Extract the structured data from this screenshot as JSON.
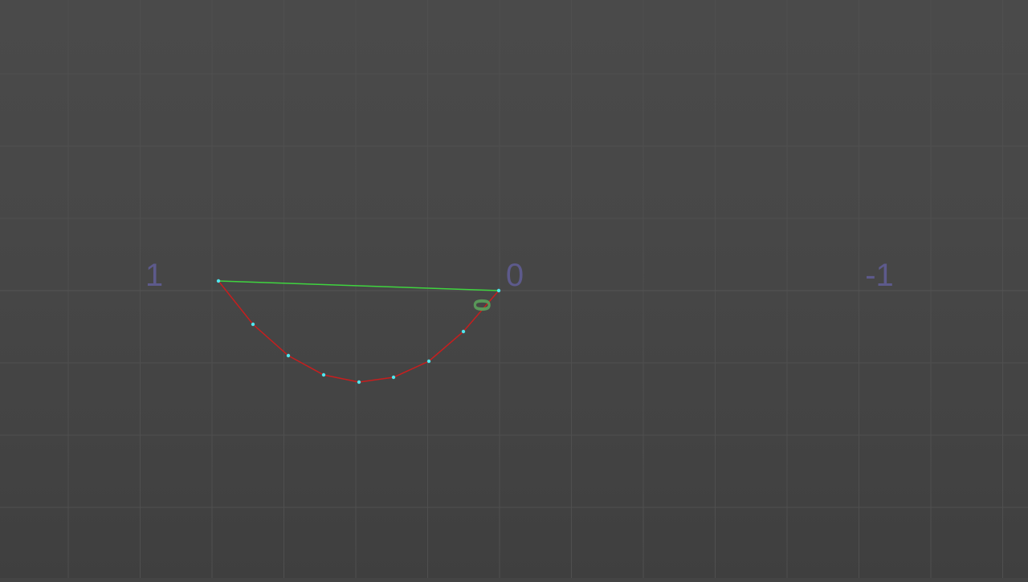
{
  "axis_labels": {
    "left": "1",
    "center": "0",
    "right": "-1"
  },
  "origin_marker": {
    "label": "0",
    "color": "#5aa05a"
  },
  "colors": {
    "grid_minor": "#4e4e4e",
    "grid_major": "#525252",
    "axis_label": "#5d5a8c",
    "chord": "#3fd43f",
    "curve": "#c81e1e",
    "vertex": "#4fe6ee"
  }
}
